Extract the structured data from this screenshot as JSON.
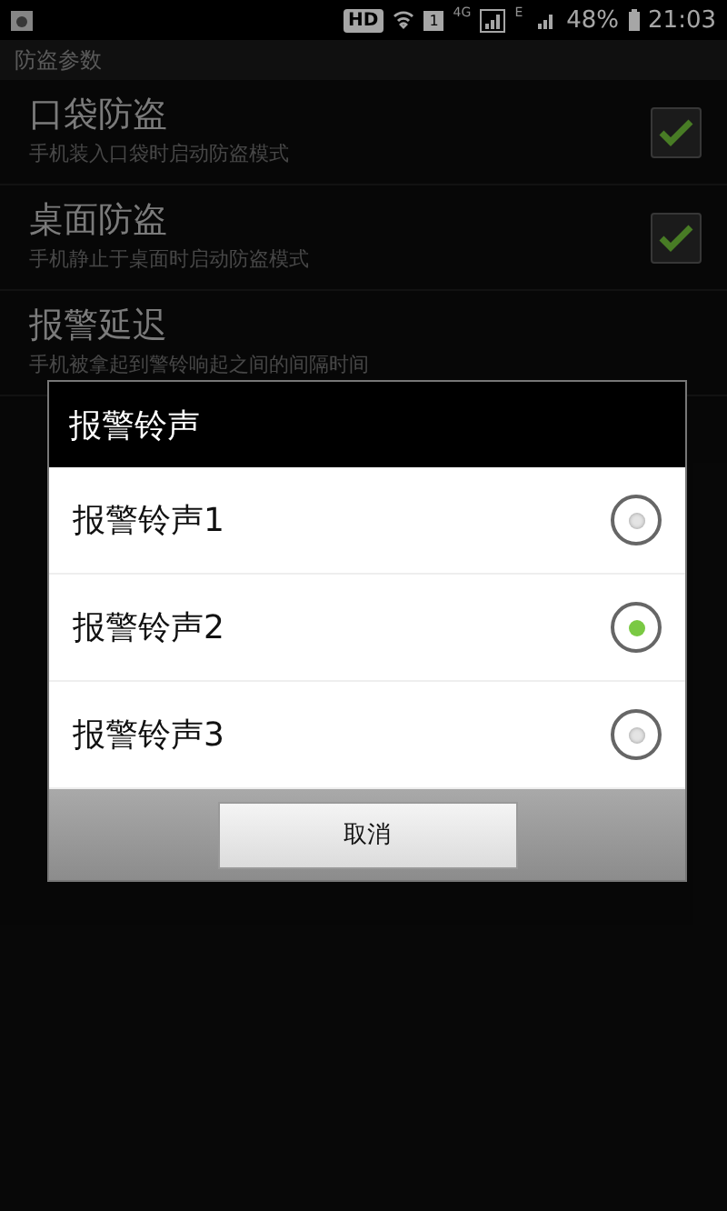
{
  "status_bar": {
    "hd": "HD",
    "sim": "1",
    "network_1": "4G",
    "network_2": "E",
    "battery": "48%",
    "time": "21:03"
  },
  "sections": [
    {
      "header": "防盗参数",
      "items": [
        {
          "kind": "checkbox",
          "title": "口袋防盗",
          "subtitle": "手机装入口袋时启动防盗模式",
          "checked": true
        },
        {
          "kind": "checkbox",
          "title": "桌面防盗",
          "subtitle": "手机静止于桌面时启动防盗模式",
          "checked": true
        },
        {
          "kind": "plain",
          "title": "报警延迟",
          "subtitle": "手机被拿起到警铃响起之间的间隔时间"
        }
      ]
    }
  ],
  "dialog": {
    "title": "报警铃声",
    "options": [
      {
        "label": "报警铃声1",
        "selected": false
      },
      {
        "label": "报警铃声2",
        "selected": true
      },
      {
        "label": "报警铃声3",
        "selected": false
      }
    ],
    "button": "取消"
  }
}
